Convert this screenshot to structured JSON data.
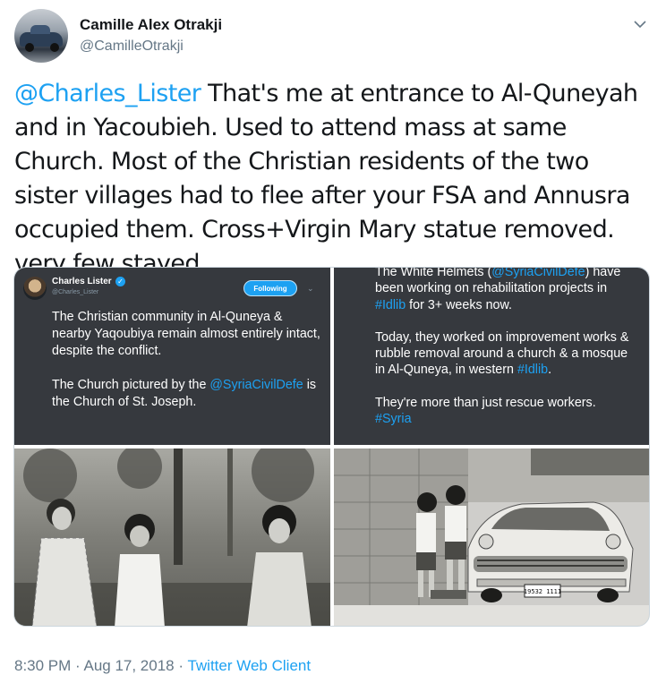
{
  "author": {
    "name": "Camille Alex Otrakji",
    "handle": "@CamilleOtrakji"
  },
  "tweet": {
    "mention": "@Charles_Lister",
    "text": " That's me at entrance to Al-Quneyah and in Yacoubieh. Used to attend mass at same Church. Most of the Christian residents of the two sister villages had to flee after your FSA and Annusra occupied them. Cross+Virgin Mary statue removed. very few stayed"
  },
  "quoted": {
    "name": "Charles Lister",
    "handle": "@Charles_Lister",
    "follow_label": "Following",
    "para1": "The Christian community in Al-Quneya & nearby Yaqoubiya remain almost entirely intact, despite the conflict.",
    "para2_pre": "The Church pictured by the ",
    "para2_link": "@SyriaCivilDefe",
    "para2_post": " is the Church of St. Joseph."
  },
  "white_helmets": {
    "line1_pre": "The White Helmets (",
    "line1_link": "@SyriaCivilDefe",
    "line1_post": ") have been working on rehabilitation projects in ",
    "line1_tag": "#Idlib",
    "line1_end": " for 3+ weeks now.",
    "para2_pre": "Today, they worked on improvement works & rubble removal around a church & a mosque in Al-Quneya, in western ",
    "para2_tag": "#Idlib",
    "para2_end": ".",
    "para3": "They're more than just rescue workers.",
    "para3_tag": "#Syria"
  },
  "photo_car": {
    "plate": "19532 1111"
  },
  "footer": {
    "time": "8:30 PM",
    "sep1": " · ",
    "date": "Aug 17, 2018",
    "sep2": " · ",
    "client": "Twitter Web Client"
  },
  "colors": {
    "link": "#1da1f2",
    "secondary": "#657786",
    "dark_card": "#36393e"
  },
  "icons": [
    "chevron-down-icon",
    "verified-icon",
    "more-chevron-icon"
  ]
}
